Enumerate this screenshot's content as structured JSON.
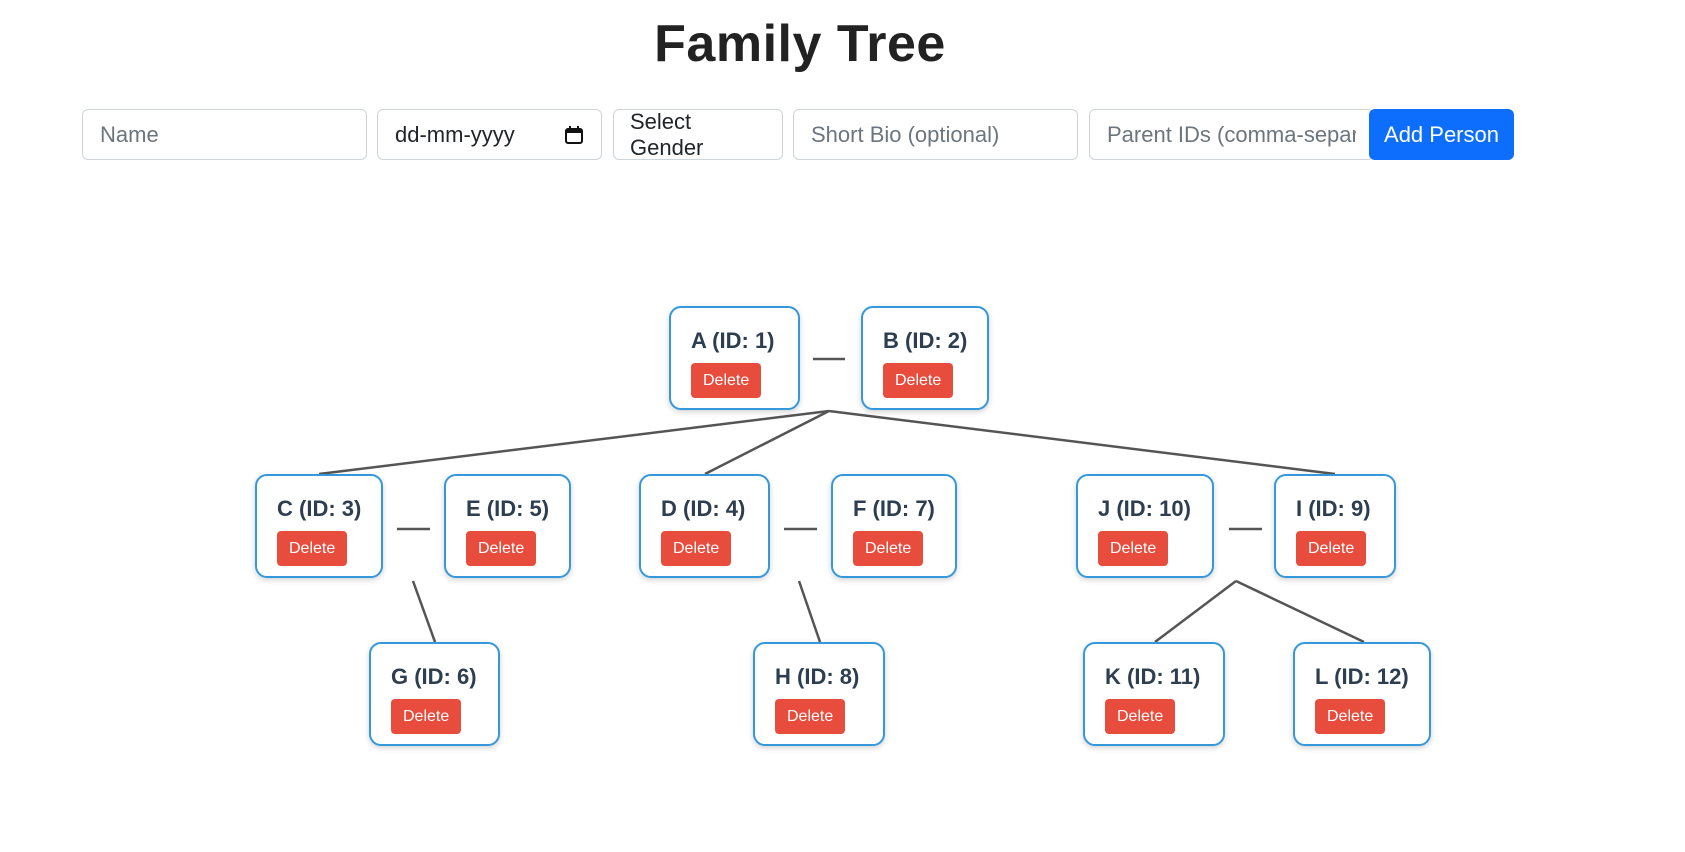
{
  "title": "Family Tree",
  "form": {
    "name_placeholder": "Name",
    "date_value": "dd-mm-yyyy",
    "gender_label": "Select Gender",
    "bio_placeholder": "Short Bio (optional)",
    "parents_placeholder": "Parent IDs (comma-separa",
    "add_label": "Add Person"
  },
  "delete_label": "Delete",
  "nodes": [
    {
      "label": "A (ID: 1)"
    },
    {
      "label": "B (ID: 2)"
    },
    {
      "label": "C (ID: 3)"
    },
    {
      "label": "E (ID: 5)"
    },
    {
      "label": "D (ID: 4)"
    },
    {
      "label": "F (ID: 7)"
    },
    {
      "label": "J (ID: 10)"
    },
    {
      "label": "I (ID: 9)"
    },
    {
      "label": "G (ID: 6)"
    },
    {
      "label": "H (ID: 8)"
    },
    {
      "label": "K (ID: 11)"
    },
    {
      "label": "L (ID: 12)"
    }
  ],
  "colors": {
    "accent": "#0d6efd",
    "node_border": "#3498db",
    "delete": "#e74c3c",
    "line": "#555555"
  }
}
